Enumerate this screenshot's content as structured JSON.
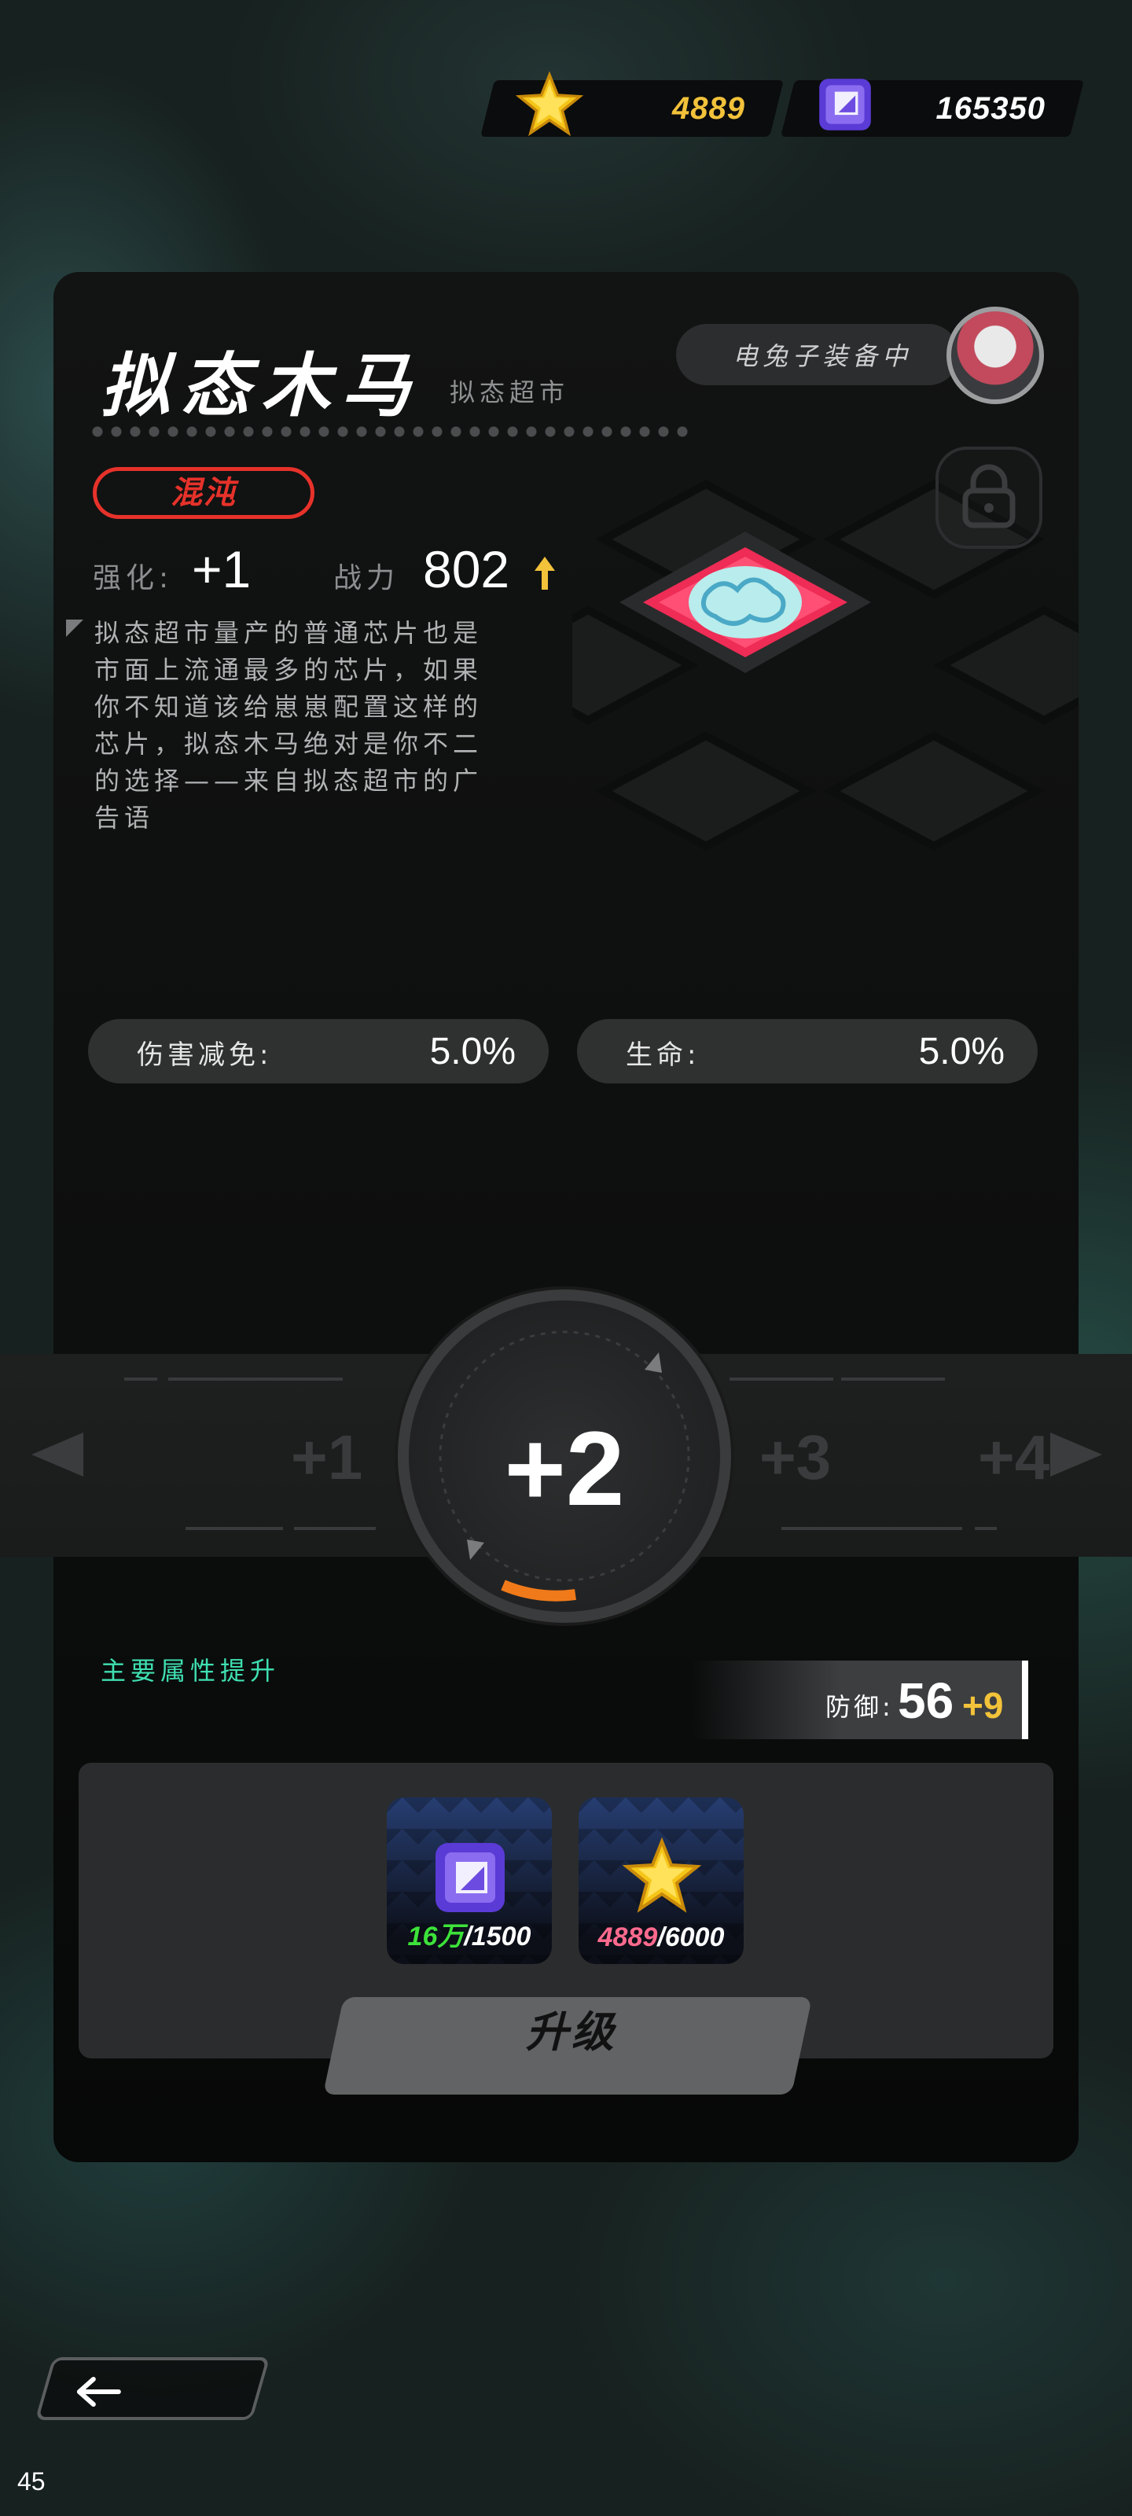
{
  "currency": {
    "gold": {
      "icon": "star-coin-icon",
      "value": "4889"
    },
    "chip": {
      "icon": "chip-cube-icon",
      "value": "165350"
    }
  },
  "item": {
    "name": "拟态木马",
    "source": "拟态超市",
    "equipped_by": "电兔子装备中",
    "rarity": "混沌",
    "enhance_label": "强化:",
    "enhance_value": "+1",
    "power_label": "战力",
    "power_value": "802",
    "description": "拟态超市量产的普通芯片也是市面上流通最多的芯片，如果你不知道该给崽崽配置这样的芯片，拟态木马绝对是你不二的选择——来自拟态超市的广告语"
  },
  "attributes": [
    {
      "label": "伤害减免:",
      "value": "5.0%"
    },
    {
      "label": "生命:",
      "value": "5.0%"
    }
  ],
  "level_selector": {
    "prev": "+1",
    "current": "+2",
    "next": "+3",
    "next2": "+4"
  },
  "upgrade": {
    "section_title": "主要属性提升",
    "defense_label": "防御:",
    "defense_value": "56",
    "defense_bonus": "+9",
    "costs": [
      {
        "icon": "chip-cube-icon",
        "have": "16万",
        "need": "/1500"
      },
      {
        "icon": "star-coin-icon",
        "have": "4889",
        "need": "/6000"
      }
    ],
    "button_label": "升级"
  },
  "footer": {
    "back_icon": "arrow-left-icon",
    "fps": "45"
  },
  "colors": {
    "accent_gold": "#f2c23a",
    "rarity_red": "#e6322a",
    "section_green": "#3fe0b1",
    "progress_orange": "#f07a1a"
  }
}
